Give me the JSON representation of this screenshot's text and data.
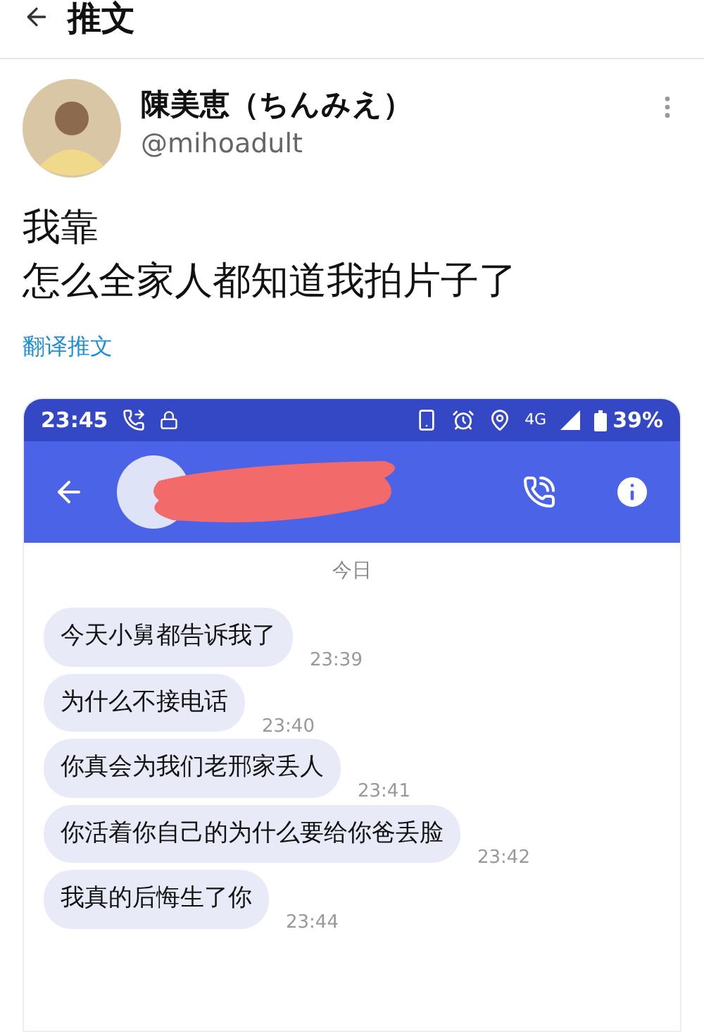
{
  "header": {
    "title": "推文"
  },
  "author": {
    "name": "陳美恵（ちんみえ）",
    "handle": "@mihoadult"
  },
  "tweet": {
    "lines": [
      "我靠",
      "怎么全家人都知道我拍片子了"
    ],
    "translate_link": "翻译推文"
  },
  "screenshot": {
    "status_bar": {
      "time": "23:45",
      "network": "4G",
      "battery": "39%"
    },
    "chat": {
      "date": "今日",
      "messages": [
        {
          "text": "今天小舅都告诉我了",
          "time": "23:39"
        },
        {
          "text": "为什么不接电话",
          "time": "23:40"
        },
        {
          "text": "你真会为我们老邢家丢人",
          "time": "23:41"
        },
        {
          "text": "你活着你自己的为什么要给你爸丢脸",
          "time": "23:42"
        },
        {
          "text": "我真的后悔生了你",
          "time": "23:44"
        }
      ]
    }
  }
}
